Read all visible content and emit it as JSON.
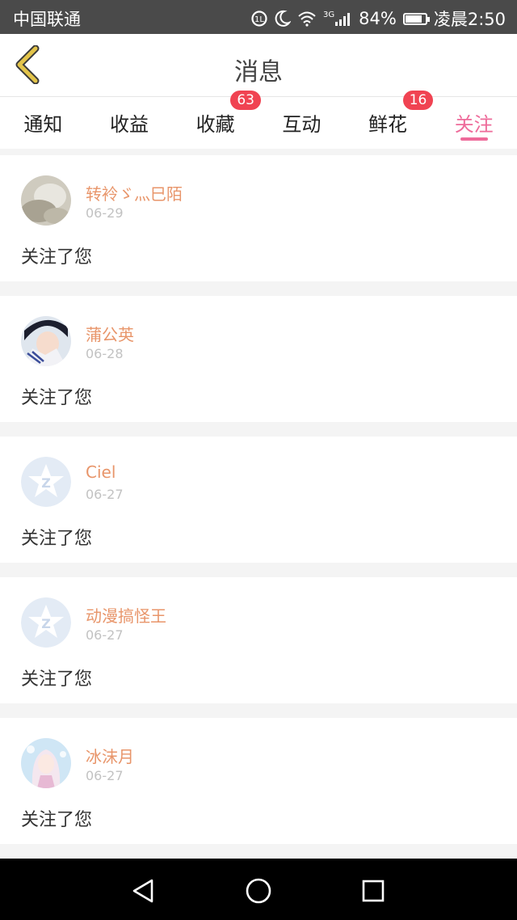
{
  "status_bar": {
    "carrier": "中国联通",
    "signal_type": "3G",
    "battery": "84%",
    "battery_level": 0.84,
    "time": "凌晨2:50"
  },
  "header": {
    "title": "消息"
  },
  "tabs": [
    {
      "label": "通知",
      "badge": "",
      "active": false
    },
    {
      "label": "收益",
      "badge": "",
      "active": false
    },
    {
      "label": "收藏",
      "badge": "63",
      "active": false
    },
    {
      "label": "互动",
      "badge": "",
      "active": false
    },
    {
      "label": "鲜花",
      "badge": "16",
      "active": false
    },
    {
      "label": "关注",
      "badge": "",
      "active": true
    }
  ],
  "notifications": [
    {
      "name": "转袊ゞ灬巳陌",
      "date": "06-29",
      "message": "关注了您",
      "avatar": "photo-avatar-icon"
    },
    {
      "name": "蒲公英",
      "date": "06-28",
      "message": "关注了您",
      "avatar": "photo-avatar-icon"
    },
    {
      "name": "Ciel",
      "date": "06-27",
      "message": "关注了您",
      "avatar": "default-star-avatar-icon"
    },
    {
      "name": "动漫搞怪王",
      "date": "06-27",
      "message": "关注了您",
      "avatar": "default-star-avatar-icon"
    },
    {
      "name": "冰沫月",
      "date": "06-27",
      "message": "关注了您",
      "avatar": "photo-avatar-icon"
    }
  ],
  "colors": {
    "accent": "#ee6b9a",
    "username": "#e8956a",
    "badge": "#f04352",
    "back_arrow": "#e3c44a"
  }
}
